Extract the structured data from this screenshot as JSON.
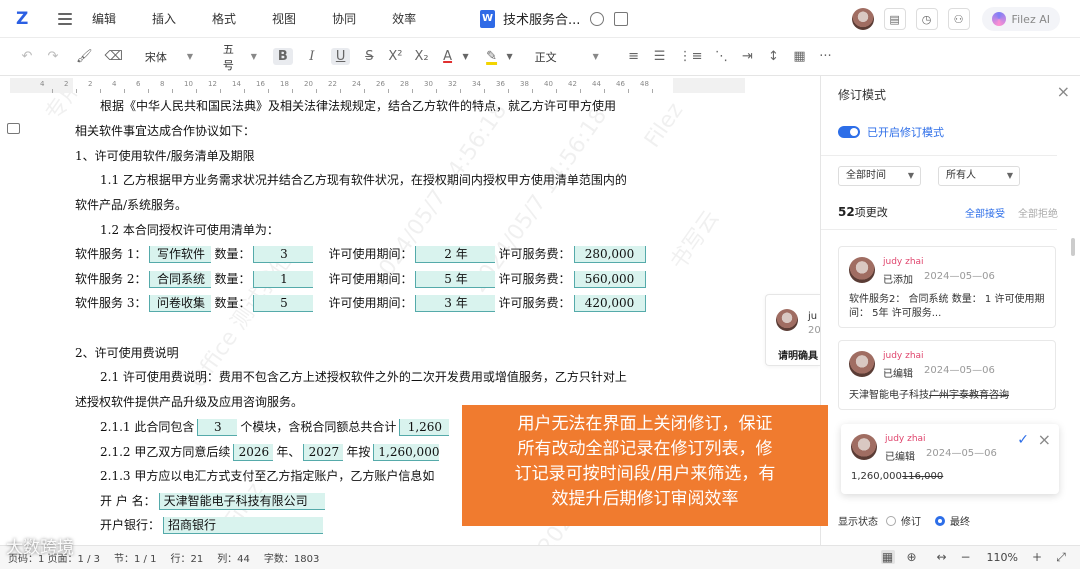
{
  "menubar": {
    "items": [
      "编辑",
      "插入",
      "格式",
      "视图",
      "协同",
      "效率"
    ],
    "doc_title": "技术服务合...",
    "doc_icon": "W",
    "ai_label": "Filez AI"
  },
  "toolbar": {
    "font": "宋体",
    "size": "五号",
    "style": "正文"
  },
  "ruler": {
    "numbers": [
      "4",
      "2",
      "2",
      "4",
      "6",
      "8",
      "10",
      "12",
      "14",
      "16",
      "18",
      "20",
      "22",
      "24",
      "26",
      "28",
      "30",
      "32",
      "34",
      "36",
      "38",
      "40",
      "42",
      "44",
      "46",
      "48"
    ]
  },
  "doc": {
    "l1": "根据《中华人民共和国民法典》及相关法律法规规定，结合乙方软件的特点，就乙方许可甲方使用",
    "l2": "相关软件事宜达成合作协议如下：",
    "l3": "1、许可使用软件/服务清单及期限",
    "l4": "1.1 乙方根据甲方业务需求状况并结合乙方现有软件状况，在授权期间内授权甲方使用清单范围内的",
    "l5": "软件产品/系统服务。",
    "l6": "1.2 本合同授权许可使用清单为：",
    "rows": [
      {
        "label": "软件服务 1：",
        "name": "写作软件",
        "qty_label": "数量：",
        "qty": "3",
        "period_label": "许可使用期间：",
        "period": "2 年",
        "fee_label": "许可服务费：",
        "fee": "280,000"
      },
      {
        "label": "软件服务 2：",
        "name": "合同系统",
        "qty_label": "数量：",
        "qty": "1",
        "period_label": "许可使用期间：",
        "period": "5 年",
        "fee_label": "许可服务费：",
        "fee": "560,000"
      },
      {
        "label": "软件服务 3：",
        "name": "问卷收集",
        "qty_label": "数量：",
        "qty": "5",
        "period_label": "许可使用期间：",
        "period": "3 年",
        "fee_label": "许可服务费：",
        "fee": "420,000"
      }
    ],
    "l10": "2、许可使用费说明",
    "l11": "2.1 许可使用费说明：费用不包含乙方上述授权软件之外的二次开发费用或增值服务，乙方只针对上",
    "l12": "述授权软件提供产品升级及应用咨询服务。",
    "l13_pre": "2.1.1 此合同包含",
    "l13_modules": "3",
    "l13_mid": "个模块，含税合同额总共合计",
    "l13_total": "1,260",
    "l14_pre": "2.1.2 甲乙双方同意后续",
    "l14_year1": "2026",
    "l14_nian1": "年、",
    "l14_year2": "2027",
    "l14_mid": "年按",
    "l14_amount": "1,260,000",
    "l15": "2.1.3 甲方应以电汇方式支付至乙方指定账户，乙方账户信息如",
    "l16_label": "开 户 名：",
    "l16_value": "天津智能电子科技有限公司",
    "l17_label": "开户银行：",
    "l17_value": "招商银行",
    "watermarks": [
      "专用",
      "Filez",
      "书写云",
      "2024/05/7 14:56:18",
      "2024/05/7 14:56:18",
      "Office 测试我他",
      "2024/05/7",
      "Filez"
    ]
  },
  "side_comment": {
    "name": "ju",
    "date": "20",
    "text": "请明确具"
  },
  "panel": {
    "title": "修订模式",
    "toggle_label": "已开启修订模式",
    "filter_time": "全部时间",
    "filter_user": "所有人",
    "count_num": "52",
    "count_unit": "项更改",
    "accept_all": "全部接受",
    "reject_all": "全部拒绝",
    "cards": [
      {
        "name": "judy zhai",
        "action": "已添加",
        "date": "2024—05—06",
        "text": "软件服务2：  合同系统  数量：    1      许可使用期间：     5年      许可服务..."
      },
      {
        "name": "judy zhai",
        "action": "已编辑",
        "date": "2024—05—06",
        "text_new": "天津智能电子科技",
        "text_old": "广州宇泰教育咨询"
      },
      {
        "name": "judy zhai",
        "action": "已编辑",
        "date": "2024—05—06",
        "text_new": "1,260,000",
        "text_old": "116,000"
      }
    ],
    "display_label": "显示状态",
    "opt_revision": "修订",
    "opt_final": "最终"
  },
  "statusbar": {
    "pages": "页码：1 页面：1 / 3",
    "section": "节：1 / 1",
    "line": "行：21",
    "col": "列：44",
    "words": "字数：1803",
    "zoom": "110%"
  },
  "overlay": {
    "lines": [
      "用户无法在界面上关闭修订，保证",
      "所有改动全部记录在修订列表，修",
      "订记录可按时间段/用户来筛选，有",
      "效提升后期修订审阅效率"
    ]
  },
  "brand": "大数跨境"
}
